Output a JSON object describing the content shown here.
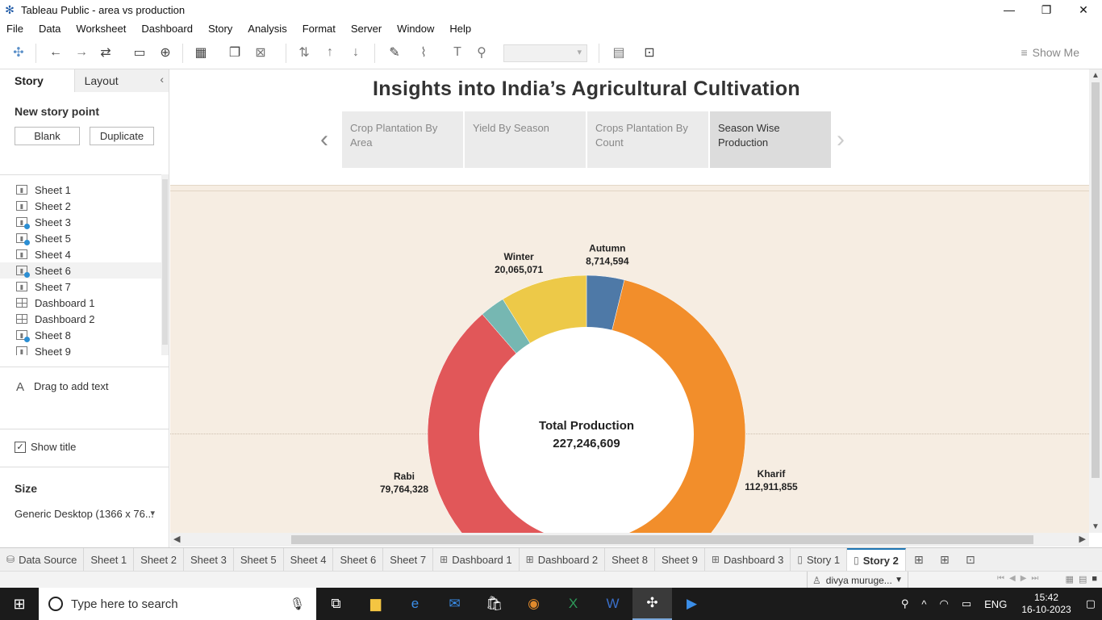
{
  "window": {
    "title": "Tableau Public - area vs production",
    "minimize": "—",
    "maximize": "❐",
    "close": "✕"
  },
  "menu": [
    "File",
    "Data",
    "Worksheet",
    "Dashboard",
    "Story",
    "Analysis",
    "Format",
    "Server",
    "Window",
    "Help"
  ],
  "toolbar": {
    "show_me": "Show Me"
  },
  "left_pane": {
    "tabs": {
      "story": "Story",
      "layout": "Layout"
    },
    "new_story_point": "New story point",
    "blank_button": "Blank",
    "duplicate_button": "Duplicate",
    "sheets": [
      {
        "label": "Sheet 1",
        "type": "sheet",
        "used": false
      },
      {
        "label": "Sheet 2",
        "type": "sheet",
        "used": false
      },
      {
        "label": "Sheet 3",
        "type": "sheet",
        "used": true
      },
      {
        "label": "Sheet 5",
        "type": "sheet",
        "used": true
      },
      {
        "label": "Sheet 4",
        "type": "sheet",
        "used": false
      },
      {
        "label": "Sheet 6",
        "type": "sheet",
        "used": true
      },
      {
        "label": "Sheet 7",
        "type": "sheet",
        "used": false
      },
      {
        "label": "Dashboard 1",
        "type": "dashboard",
        "used": false
      },
      {
        "label": "Dashboard 2",
        "type": "dashboard",
        "used": false
      },
      {
        "label": "Sheet 8",
        "type": "sheet",
        "used": true
      },
      {
        "label": "Sheet 9",
        "type": "sheet",
        "used": false
      },
      {
        "label": "Dashboard 3",
        "type": "dashboard",
        "used": false
      }
    ],
    "drag_to_add_text": "Drag to add text",
    "show_title": "Show title",
    "size_title": "Size",
    "size_value": "Generic Desktop (1366 x 76..."
  },
  "story": {
    "title": "Insights into India’s Agricultural Cultivation",
    "points": [
      {
        "label": "Crop Plantation By Area",
        "active": false
      },
      {
        "label": "Yield By Season",
        "active": false
      },
      {
        "label": "Crops Plantation By Count",
        "active": false
      },
      {
        "label": "Season Wise Production",
        "active": true
      }
    ]
  },
  "chart_data": {
    "type": "pie",
    "subtype": "donut",
    "center_title": "Total Production",
    "center_value": "227,246,609",
    "series": [
      {
        "name": "Autumn",
        "value": 8714594,
        "label": "8,714,594",
        "color": "#4e79a7"
      },
      {
        "name": "Kharif",
        "value": 112911855,
        "label": "112,911,855",
        "color": "#f28e2b"
      },
      {
        "name": "Rabi",
        "value": 79764328,
        "label": "79,764,328",
        "color": "#e15759"
      },
      {
        "name": "",
        "value": 5790761,
        "label": "",
        "color": "#76b7b2"
      },
      {
        "name": "Winter",
        "value": 20065071,
        "label": "20,065,071",
        "color": "#edc948"
      }
    ]
  },
  "sheet_tabs": [
    {
      "label": "Data Source",
      "icon": "database-icon",
      "glyph": "⛁"
    },
    {
      "label": "Sheet 1"
    },
    {
      "label": "Sheet 2"
    },
    {
      "label": "Sheet 3"
    },
    {
      "label": "Sheet 5"
    },
    {
      "label": "Sheet 4"
    },
    {
      "label": "Sheet 6"
    },
    {
      "label": "Sheet 7"
    },
    {
      "label": "Dashboard 1",
      "icon": "dashboard-icon",
      "glyph": "⊞"
    },
    {
      "label": "Dashboard 2",
      "icon": "dashboard-icon",
      "glyph": "⊞"
    },
    {
      "label": "Sheet 8"
    },
    {
      "label": "Sheet 9"
    },
    {
      "label": "Dashboard 3",
      "icon": "dashboard-icon",
      "glyph": "⊞"
    },
    {
      "label": "Story 1",
      "icon": "story-icon",
      "glyph": "▯"
    },
    {
      "label": "Story 2",
      "icon": "story-icon",
      "glyph": "▯",
      "active": true
    }
  ],
  "status": {
    "user": "divya muruge..."
  },
  "taskbar": {
    "search_placeholder": "Type here to search",
    "language": "ENG",
    "time": "15:42",
    "date": "16-10-2023"
  }
}
